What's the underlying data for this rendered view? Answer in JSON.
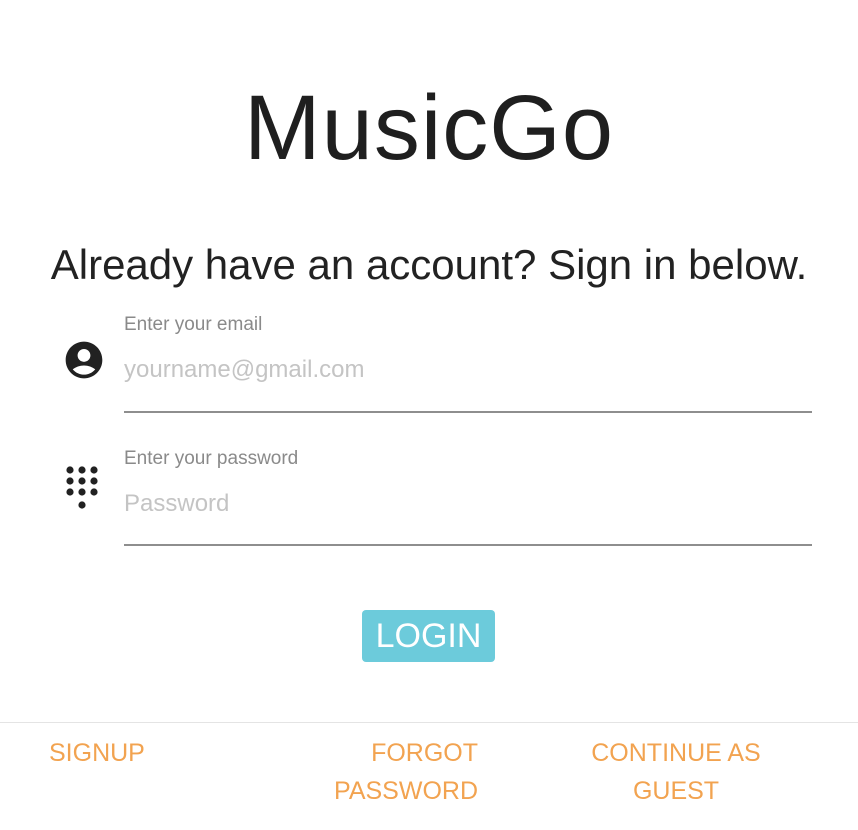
{
  "app": {
    "title": "MusicGo",
    "subtitle": "Already have an account? Sign in below."
  },
  "email_field": {
    "label": "Enter your email",
    "placeholder": "yourname@gmail.com",
    "value": "",
    "icon": "account-circle-icon"
  },
  "password_field": {
    "label": "Enter your password",
    "placeholder": "Password",
    "value": "",
    "icon": "dialpad-icon"
  },
  "login_button": {
    "label": "LOGIN"
  },
  "footer": {
    "signup_label": "SIGNUP",
    "forgot_label": "FORGOT PASSWORD",
    "guest_label": "CONTINUE AS GUEST"
  },
  "colors": {
    "accent": "#6ccbdb",
    "link": "#f2a350",
    "text": "#212121",
    "label": "#8a8a8a",
    "placeholder": "#c4c4c4",
    "underline": "#8e8e8e"
  }
}
